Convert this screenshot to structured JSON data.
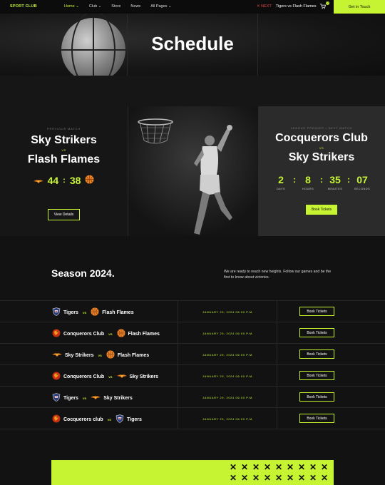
{
  "nav": {
    "brand": "SPORT CLUB",
    "items": [
      {
        "label": "Home ⌄",
        "active": true
      },
      {
        "label": "Club ⌄",
        "active": false
      },
      {
        "label": "Store",
        "active": false
      },
      {
        "label": "News",
        "active": false
      },
      {
        "label": "All Pages ⌄",
        "active": false
      }
    ],
    "next_tag": "✕ NEXT",
    "next_match": "Tigers vs Flash Flames",
    "cart_count": "0",
    "cta": "Get in Touch"
  },
  "hero": {
    "title": "Schedule"
  },
  "previous_match": {
    "label": "PREVIOUS MATCH",
    "team1": "Sky Strikers",
    "vs": "VS",
    "team2": "Flash Flames",
    "score1": "44",
    "score2": "38",
    "button": "View Details"
  },
  "next_match": {
    "label": "LEAGUE PREMIER • NEXT MATCH",
    "team1": "Cocquerors Club",
    "vs": "VS",
    "team2": "Sky Strikers",
    "countdown": [
      {
        "value": "2",
        "label": "DAYS"
      },
      {
        "value": "8",
        "label": "HOURS"
      },
      {
        "value": "35",
        "label": "MINUTES"
      },
      {
        "value": "07",
        "label": "SECONDS"
      }
    ],
    "button": "Book Tickets"
  },
  "season": {
    "title": "Season 2024.",
    "description": "We are ready to reach new heights. Follow our games and be the first to know about victories."
  },
  "fixtures": [
    {
      "team1": "Tigers",
      "icon1": "shield-icon",
      "team2": "Flash Flames",
      "icon2": "ball-icon",
      "date": "JANUARY 29, 2024 06:00 P.M.",
      "button": "Book Tickets"
    },
    {
      "team1": "Conquerors Club",
      "icon1": "oriole-icon",
      "team2": "Flash Flames",
      "icon2": "ball-icon",
      "date": "JANUARY 29, 2024 06:00 P.M.",
      "button": "Book Tickets"
    },
    {
      "team1": "Sky Strikers",
      "icon1": "wings-icon",
      "team2": "Flash Flames",
      "icon2": "ball-icon",
      "date": "JANUARY 29, 2024 06:00 P.M.",
      "button": "Book Tickets"
    },
    {
      "team1": "Conquerors Club",
      "icon1": "oriole-icon",
      "team2": "Sky Strikers",
      "icon2": "wings-icon",
      "date": "JANUARY 29, 2024 06:00 P.M.",
      "button": "Book Tickets"
    },
    {
      "team1": "Tigers",
      "icon1": "shield-icon",
      "team2": "Sky Strikers",
      "icon2": "wings-icon",
      "date": "JANUARY 29, 2024 06:00 P.M.",
      "button": "Book Tickets"
    },
    {
      "team1": "Cocquerors club",
      "icon1": "oriole-icon",
      "team2": "Tigers",
      "icon2": "shield-icon",
      "date": "JANUARY 29, 2024 06:00 P.M.",
      "button": "Book Tickets"
    }
  ],
  "fixture_vs": "VS",
  "colors": {
    "accent": "#c6f432",
    "background": "#121212",
    "panel": "#2b2b2b",
    "alert": "#e04a4a"
  }
}
